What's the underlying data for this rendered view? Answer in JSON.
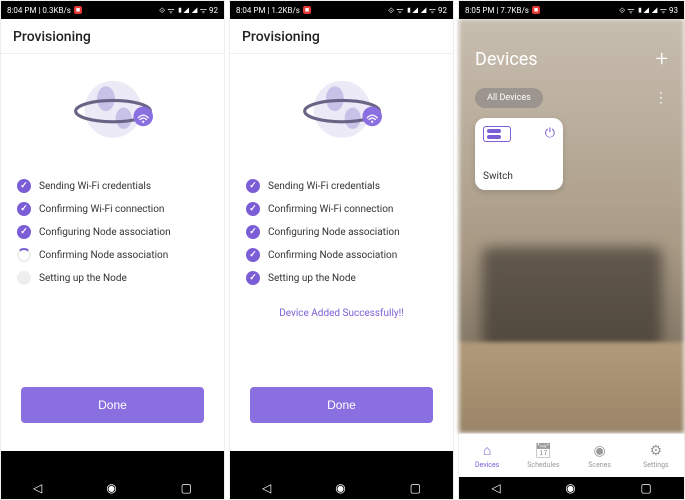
{
  "statusbar": {
    "s1": {
      "left": "8:04 PM | 0.3KB/s",
      "right": "⟐ ᯤ ▮◢ ◢ ᯤ 92"
    },
    "s2": {
      "left": "8:04 PM | 1.2KB/s",
      "right": "⟐ ᯤ ▮◢ ◢ ᯤ 92"
    },
    "s3": {
      "left": "8:05 PM | 7.7KB/s",
      "right": "⟐ ᯤ ▮◢ ◢ ᯤ 93"
    }
  },
  "provisioning": {
    "title": "Provisioning",
    "steps": [
      "Sending Wi-Fi credentials",
      "Confirming Wi-Fi connection",
      "Configuring Node association",
      "Confirming Node association",
      "Setting up the Node"
    ],
    "success": "Device Added Successfully!!",
    "done": "Done"
  },
  "devices": {
    "title": "Devices",
    "filter": "All Devices",
    "card_label": "Switch",
    "tabs": [
      "Devices",
      "Schedules",
      "Scenes",
      "Settings"
    ]
  }
}
